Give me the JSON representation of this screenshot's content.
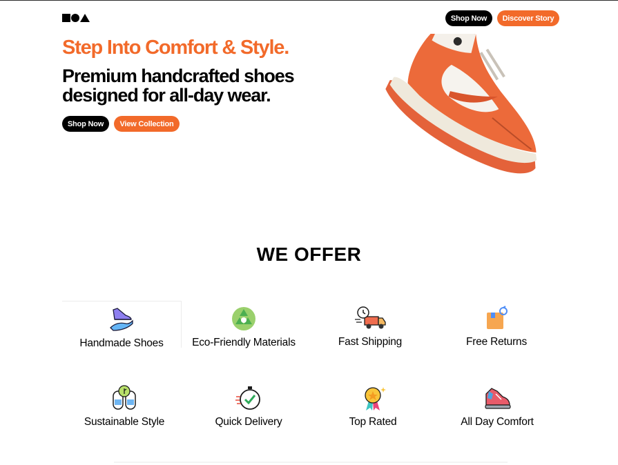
{
  "header": {
    "shop_now_label": "Shop Now",
    "discover_story_label": "Discover Story"
  },
  "hero": {
    "title": "Step Into Comfort & Style.",
    "subtitle": "Premium handcrafted shoes designed for all-day wear.",
    "shop_now_label": "Shop Now",
    "view_collection_label": "View Collection",
    "image_icon": "orange-sneaker"
  },
  "offer": {
    "title": "WE OFFER",
    "items": [
      {
        "label": "Handmade Shoes",
        "icon": "shoe-hand-icon"
      },
      {
        "label": "Eco-Friendly Materials",
        "icon": "recycle-icon"
      },
      {
        "label": "Fast Shipping",
        "icon": "delivery-truck-icon"
      },
      {
        "label": "Free Returns",
        "icon": "return-box-icon"
      },
      {
        "label": "Sustainable Style",
        "icon": "eco-sandals-icon"
      },
      {
        "label": "Quick Delivery",
        "icon": "stopwatch-icon"
      },
      {
        "label": "Top Rated",
        "icon": "medal-icon"
      },
      {
        "label": "All Day Comfort",
        "icon": "sneaker-icon"
      }
    ]
  },
  "colors": {
    "accent": "#f26a2a",
    "dark": "#000000",
    "background": "#ffffff"
  }
}
